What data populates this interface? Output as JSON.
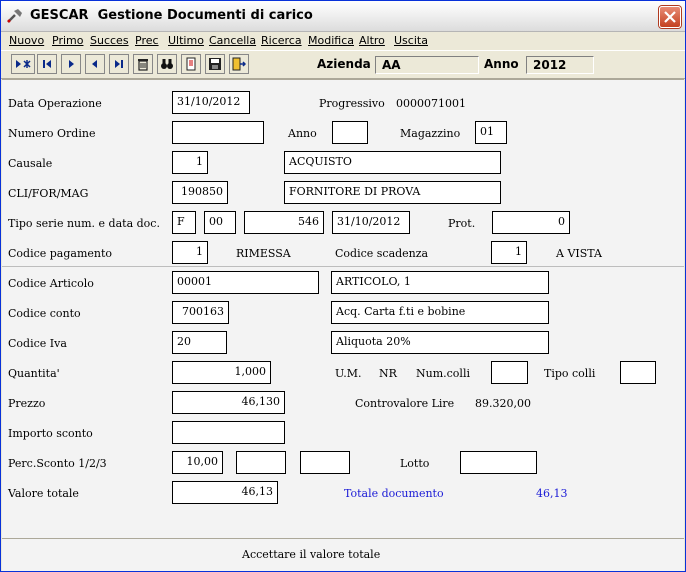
{
  "window": {
    "app_name": "GESCAR",
    "title": "Gestione Documenti di carico"
  },
  "menu": [
    "Nuovo",
    "Primo",
    "Succes",
    "Prec",
    "Ultimo",
    "Cancella",
    "Ricerca",
    "Modifica",
    "Altro",
    "Uscita"
  ],
  "toolbar": {
    "azienda_label": "Azienda",
    "azienda_value": "AA",
    "anno_label": "Anno",
    "anno_value": "2012"
  },
  "header": {
    "data_operazione_label": "Data Operazione",
    "data_operazione": "31/10/2012",
    "progressivo_label": "Progressivo",
    "progressivo": "0000071001",
    "numero_ordine_label": "Numero Ordine",
    "numero_ordine": "",
    "anno_label": "Anno",
    "anno": "",
    "magazzino_label": "Magazzino",
    "magazzino": "01",
    "causale_label": "Causale",
    "causale_code": "1",
    "causale_desc": "ACQUISTO",
    "cli_label": "CLI/FOR/MAG",
    "cli_code": "190850",
    "cli_desc": "FORNITORE DI PROVA",
    "tipo_serie_label": "Tipo serie num. e data doc.",
    "tipo": "F",
    "serie": "00",
    "numero": "546",
    "data_doc": "31/10/2012",
    "prot_label": "Prot.",
    "prot": "0",
    "pagamento_label": "Codice pagamento",
    "pagamento_code": "1",
    "pagamento_desc": "RIMESSA",
    "scadenza_label": "Codice scadenza",
    "scadenza_code": "1",
    "scadenza_desc": "A VISTA"
  },
  "riga": {
    "articolo_label": "Codice Articolo",
    "articolo_code": "00001",
    "articolo_desc": "ARTICOLO, 1",
    "conto_label": "Codice conto",
    "conto_code": "700163",
    "conto_desc": "Acq. Carta f.ti e bobine",
    "iva_label": "Codice Iva",
    "iva_code": "20",
    "iva_desc": "Aliquota 20%",
    "quantita_label": "Quantita'",
    "quantita": "1,000",
    "um_label": "U.M.",
    "um": "NR",
    "num_colli_label": "Num.colli",
    "num_colli": "",
    "tipo_colli_label": "Tipo colli",
    "tipo_colli": "",
    "prezzo_label": "Prezzo",
    "prezzo": "46,130",
    "controvalore_label": "Controvalore Lire",
    "controvalore": "89.320,00",
    "importo_sconto_label": "Importo sconto",
    "importo_sconto": "",
    "perc_sconto_label": "Perc.Sconto 1/2/3",
    "sconto1": "10,00",
    "sconto2": "",
    "sconto3": "",
    "lotto_label": "Lotto",
    "lotto": "",
    "valore_totale_label": "Valore totale",
    "valore_totale": "46,13",
    "totale_documento_label": "Totale documento",
    "totale_documento": "46,13"
  },
  "status": {
    "message": "Accettare il valore totale"
  },
  "colors": {
    "accent_blue": "#1a1ad6",
    "close_red": "#c4401f"
  }
}
